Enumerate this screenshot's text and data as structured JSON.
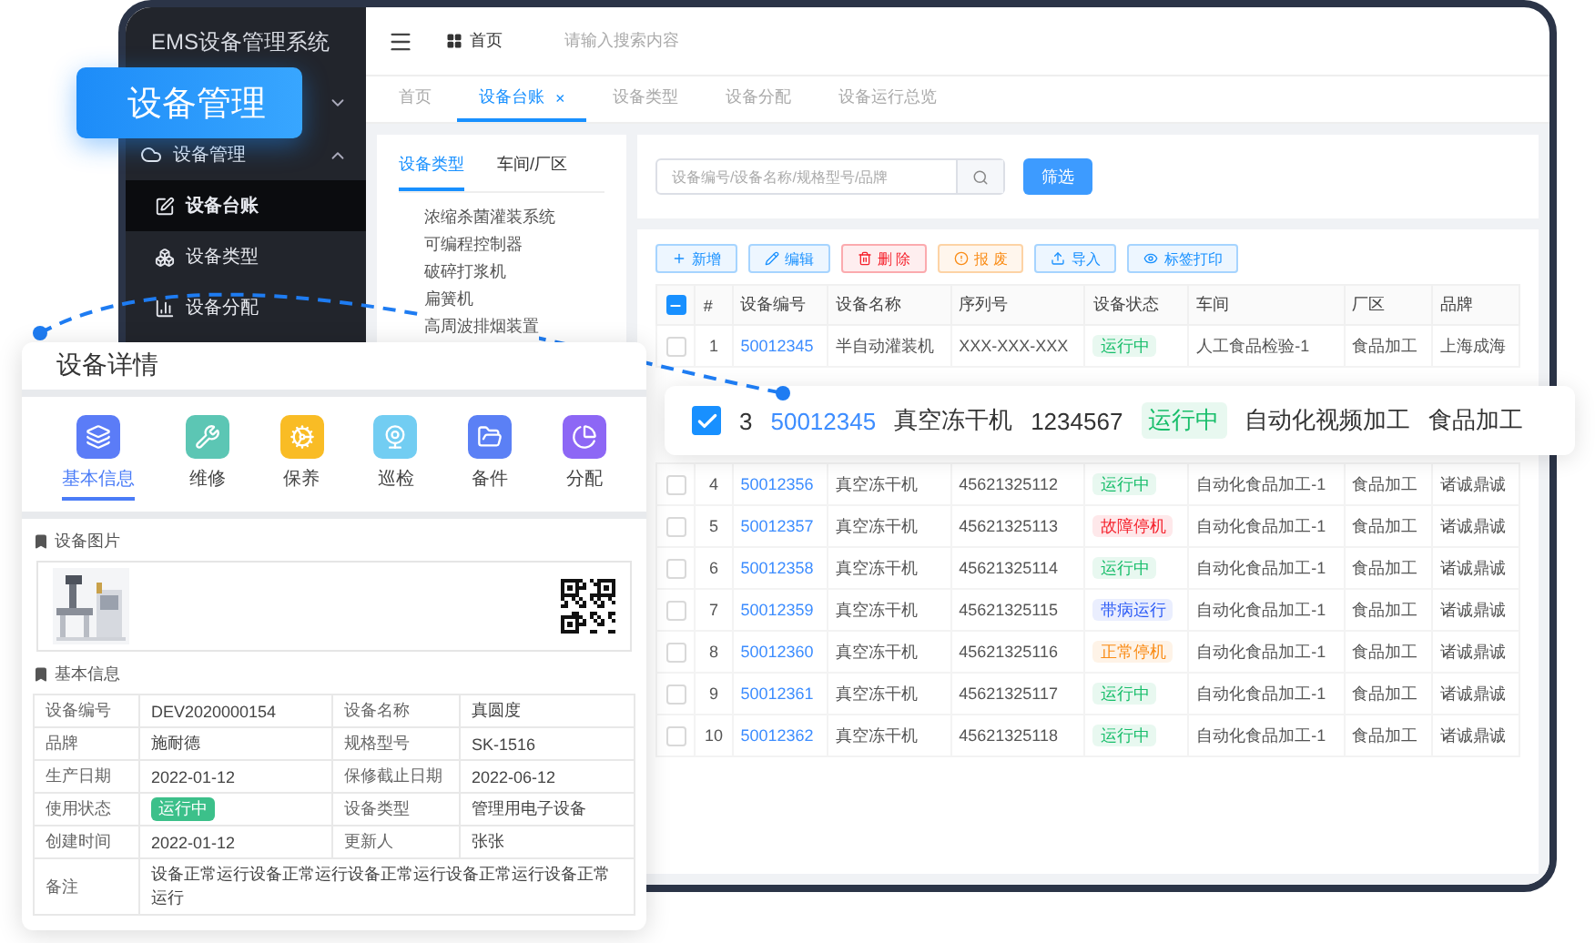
{
  "badge": {
    "text": "设备管理"
  },
  "sidebar": {
    "title": "EMS设备管理系统",
    "items": [
      {
        "expanded": false
      },
      {
        "label": "设备管理",
        "expanded": true,
        "children": [
          {
            "label": "设备台账",
            "kind": "ledger",
            "selected": true
          },
          {
            "label": "设备类型",
            "kind": "types",
            "selected": false
          },
          {
            "label": "设备分配",
            "kind": "assign",
            "selected": false
          }
        ]
      }
    ]
  },
  "header": {
    "home": "首页",
    "search_placeholder": "请输入搜索内容"
  },
  "tabs": [
    {
      "label": "首页",
      "selected": false
    },
    {
      "label": "设备台账",
      "selected": true,
      "close": "×"
    },
    {
      "label": "设备类型",
      "selected": false
    },
    {
      "label": "设备分配",
      "selected": false
    },
    {
      "label": "设备运行总览",
      "selected": false
    }
  ],
  "category_panel": {
    "tabs": [
      {
        "label": "设备类型",
        "selected": true
      },
      {
        "label": "车间/厂区",
        "selected": false
      }
    ],
    "items": [
      "浓缩杀菌灌装系统",
      "可编程控制器",
      "破碎打浆机",
      "扁簧机",
      "高周波排烟装置"
    ]
  },
  "filter": {
    "placeholder": "设备编号/设备名称/规格型号/品牌",
    "button": "筛选"
  },
  "toolbar": [
    {
      "label": "新增",
      "kind": "add"
    },
    {
      "label": "编辑",
      "kind": "edit"
    },
    {
      "label": "删 除",
      "kind": "delete"
    },
    {
      "label": "报 废",
      "kind": "scrap"
    },
    {
      "label": "导入",
      "kind": "import"
    },
    {
      "label": "标签打印",
      "kind": "print"
    }
  ],
  "table": {
    "header_indeterminate": true,
    "columns": [
      "#",
      "设备编号",
      "设备名称",
      "序列号",
      "设备状态",
      "车间",
      "厂区",
      "品牌"
    ],
    "rows": [
      {
        "checked": false,
        "index": "1",
        "code": "50012345",
        "name": "半自动灌装机",
        "serial": "XXX-XXX-XXX",
        "status": {
          "text": "运行中",
          "color": "#19be6b"
        },
        "workshop": "人工食品检验-1",
        "area": "食品加工",
        "brand": "上海成海"
      },
      {
        "checked": false,
        "index": "4",
        "code": "50012356",
        "name": "真空冻干机",
        "serial": "45621325112",
        "status": {
          "text": "运行中",
          "color": "#19be6b"
        },
        "workshop": "自动化食品加工-1",
        "area": "食品加工",
        "brand": "诸诚鼎诚"
      },
      {
        "checked": false,
        "index": "5",
        "code": "50012357",
        "name": "真空冻干机",
        "serial": "45621325113",
        "status": {
          "text": "故障停机",
          "color": "#f5222d"
        },
        "workshop": "自动化食品加工-1",
        "area": "食品加工",
        "brand": "诸诚鼎诚"
      },
      {
        "checked": false,
        "index": "6",
        "code": "50012358",
        "name": "真空冻干机",
        "serial": "45621325114",
        "status": {
          "text": "运行中",
          "color": "#19be6b"
        },
        "workshop": "自动化食品加工-1",
        "area": "食品加工",
        "brand": "诸诚鼎诚"
      },
      {
        "checked": false,
        "index": "7",
        "code": "50012359",
        "name": "真空冻干机",
        "serial": "45621325115",
        "status": {
          "text": "带病运行",
          "color": "#2d5cf6"
        },
        "workshop": "自动化食品加工-1",
        "area": "食品加工",
        "brand": "诸诚鼎诚"
      },
      {
        "checked": false,
        "index": "8",
        "code": "50012360",
        "name": "真空冻干机",
        "serial": "45621325116",
        "status": {
          "text": "正常停机",
          "color": "#fa8c16"
        },
        "workshop": "自动化食品加工-1",
        "area": "食品加工",
        "brand": "诸诚鼎诚"
      },
      {
        "checked": false,
        "index": "9",
        "code": "50012361",
        "name": "真空冻干机",
        "serial": "45621325117",
        "status": {
          "text": "运行中",
          "color": "#19be6b"
        },
        "workshop": "自动化食品加工-1",
        "area": "食品加工",
        "brand": "诸诚鼎诚"
      },
      {
        "checked": false,
        "index": "10",
        "code": "50012362",
        "name": "真空冻干机",
        "serial": "45621325118",
        "status": {
          "text": "运行中",
          "color": "#19be6b"
        },
        "workshop": "自动化食品加工-1",
        "area": "食品加工",
        "brand": "诸诚鼎诚"
      }
    ]
  },
  "highlight_row": {
    "checked": true,
    "index": "3",
    "code": "50012345",
    "name": "真空冻干机",
    "serial": "1234567",
    "status": {
      "text": "运行中",
      "color": "#19be6b"
    },
    "workshop": "自动化视频加工",
    "area": "食品加工"
  },
  "detail": {
    "title": "设备详情",
    "tabs": [
      {
        "label": "基本信息",
        "kind": "layers",
        "color": "#5b7cf7",
        "selected": true
      },
      {
        "label": "维修",
        "kind": "wrench",
        "color": "#5cc6b4",
        "selected": false
      },
      {
        "label": "保养",
        "kind": "cog",
        "color": "#f9bc25",
        "selected": false
      },
      {
        "label": "巡检",
        "kind": "webcam",
        "color": "#72cdf2",
        "selected": false
      },
      {
        "label": "备件",
        "kind": "folder",
        "color": "#5b80f5",
        "selected": false
      },
      {
        "label": "分配",
        "kind": "pie",
        "color": "#8d67f5",
        "selected": false
      }
    ],
    "photo_section": "设备图片",
    "info_section": "基本信息",
    "info": [
      {
        "label": "设备编号",
        "value": "DEV2020000154",
        "kind": "text"
      },
      {
        "label": "设备名称",
        "value": "真圆度",
        "kind": "text"
      },
      {
        "label": "品牌",
        "value": "施耐德",
        "kind": "text"
      },
      {
        "label": "规格型号",
        "value": "SK-1516",
        "kind": "text"
      },
      {
        "label": "生产日期",
        "value": "2022-01-12",
        "kind": "text"
      },
      {
        "label": "保修截止日期",
        "value": "2022-06-12",
        "kind": "text"
      },
      {
        "label": "使用状态",
        "value": "运行中",
        "kind": "tag"
      },
      {
        "label": "设备类型",
        "value": "管理用电子设备",
        "kind": "text"
      },
      {
        "label": "创建时间",
        "value": "2022-01-12",
        "kind": "text"
      },
      {
        "label": "更新人",
        "value": "张张",
        "kind": "text"
      }
    ],
    "remark": {
      "label": "备注",
      "value": "设备正常运行设备正常运行设备正常运行设备正常运行设备正常运行"
    }
  }
}
